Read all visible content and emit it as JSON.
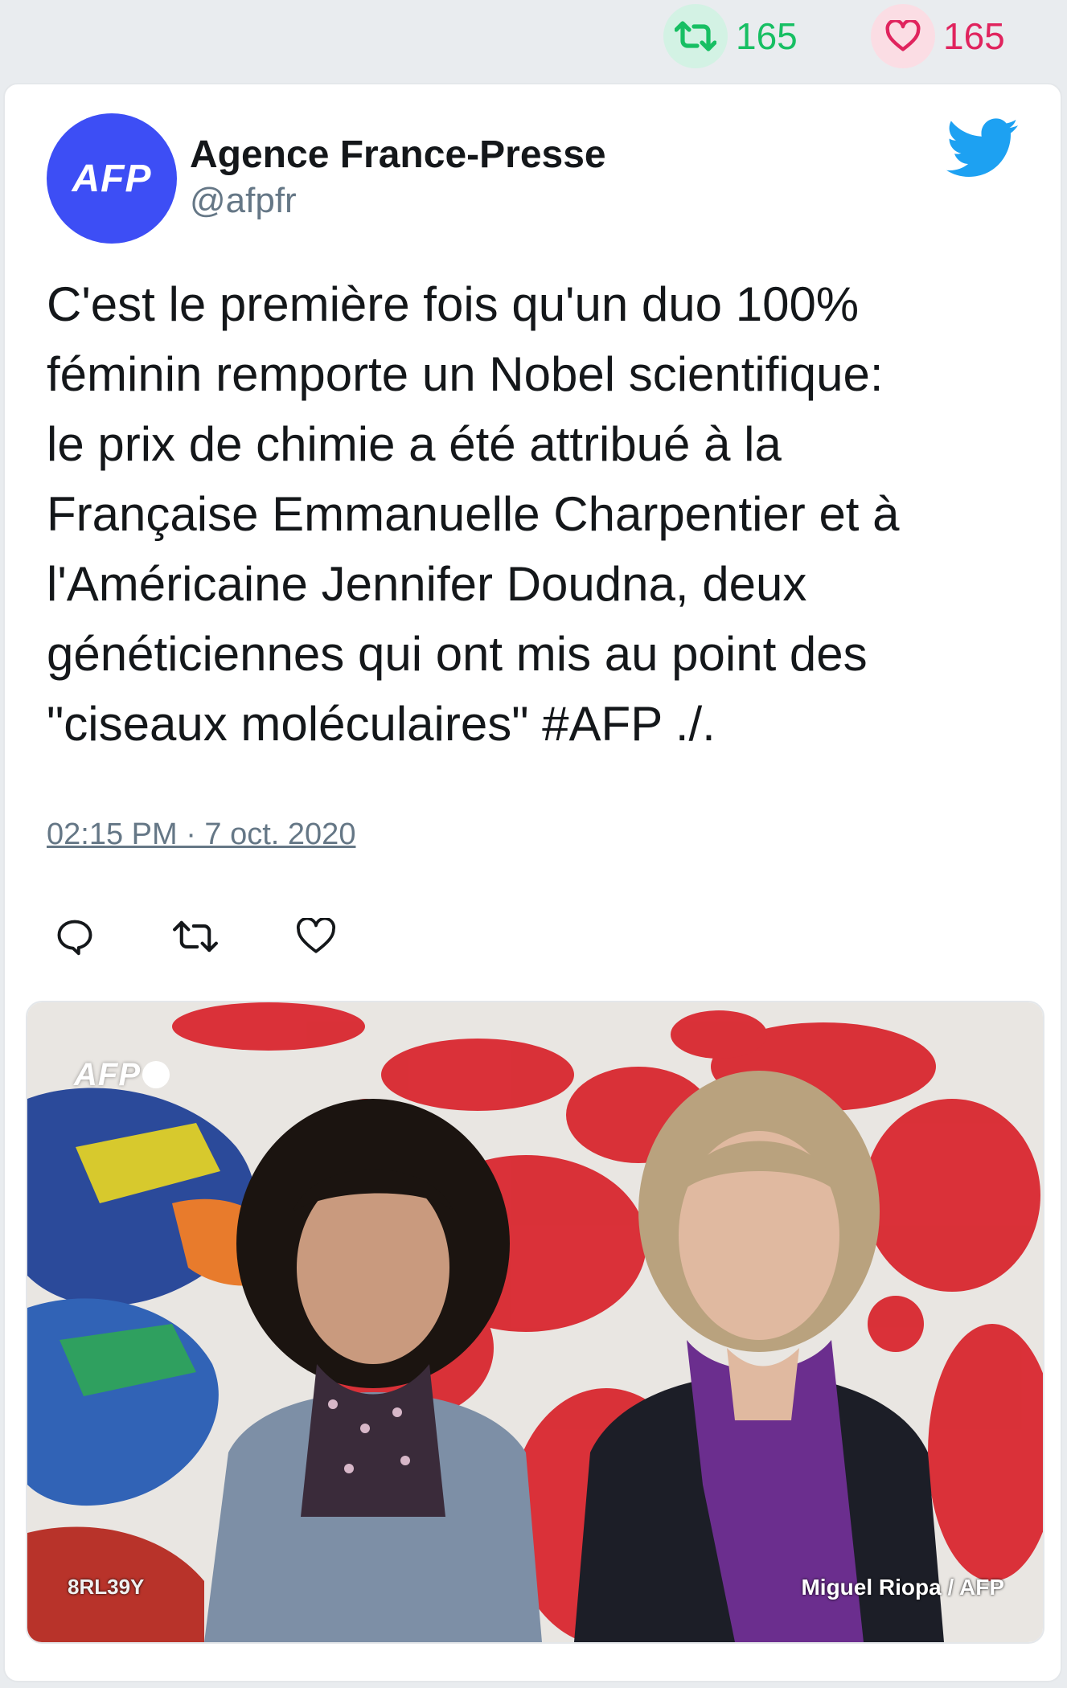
{
  "top_stats": {
    "retweet_count": "165",
    "like_count": "165",
    "retweet_icon": "retweet-icon",
    "like_icon": "heart-icon"
  },
  "tweet": {
    "avatar_text": "AFP",
    "author_name": "Agence France-Presse",
    "author_handle": "@afpfr",
    "brand_icon": "twitter-bird-icon",
    "text": "C'est le première fois qu'un duo 100%\nféminin remporte un Nobel scientifique:\nle prix de chimie a été attribué à la\nFrançaise Emmanuelle Charpentier et à\nl'Américaine Jennifer Doudna, deux\ngénéticiennes qui ont mis au point des\n\"ciseaux moléculaires\" #AFP ./.",
    "timestamp": "02:15 PM · 7 oct. 2020",
    "actions": [
      "reply-icon",
      "retweet-icon",
      "heart-icon"
    ]
  },
  "photo": {
    "watermark": "AFP",
    "code": "8RL39Y",
    "credit": "Miguel Riopa / AFP"
  },
  "colors": {
    "background": "#e9ecef",
    "retweet_green": "#17bf63",
    "like_red": "#e0245e",
    "twitter_blue": "#1da1f2",
    "afp_blue": "#3d4ef5",
    "muted": "#657786"
  }
}
